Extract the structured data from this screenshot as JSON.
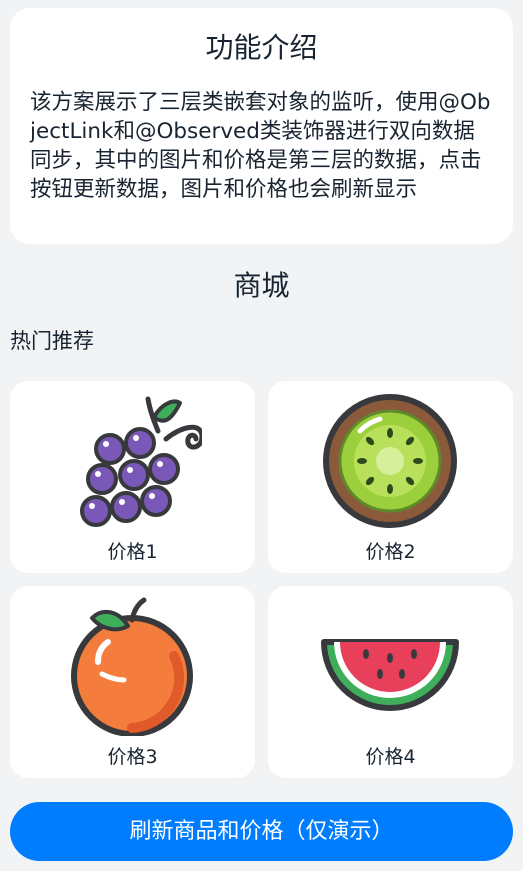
{
  "intro": {
    "title": "功能介绍",
    "description": "该方案展示了三层类嵌套对象的监听，使用@ObjectLink和@Observed类装饰器进行双向数据同步，其中的图片和价格是第三层的数据，点击按钮更新数据，图片和价格也会刷新显示"
  },
  "shop": {
    "title": "商城",
    "section_label": "热门推荐",
    "products": [
      {
        "image_icon": "grapes-icon",
        "price_label": "价格1"
      },
      {
        "image_icon": "kiwi-icon",
        "price_label": "价格2"
      },
      {
        "image_icon": "orange-icon",
        "price_label": "价格3"
      },
      {
        "image_icon": "watermelon-icon",
        "price_label": "价格4"
      }
    ]
  },
  "action": {
    "refresh_label": "刷新商品和价格（仅演示）",
    "button_color": "#007DFF"
  }
}
